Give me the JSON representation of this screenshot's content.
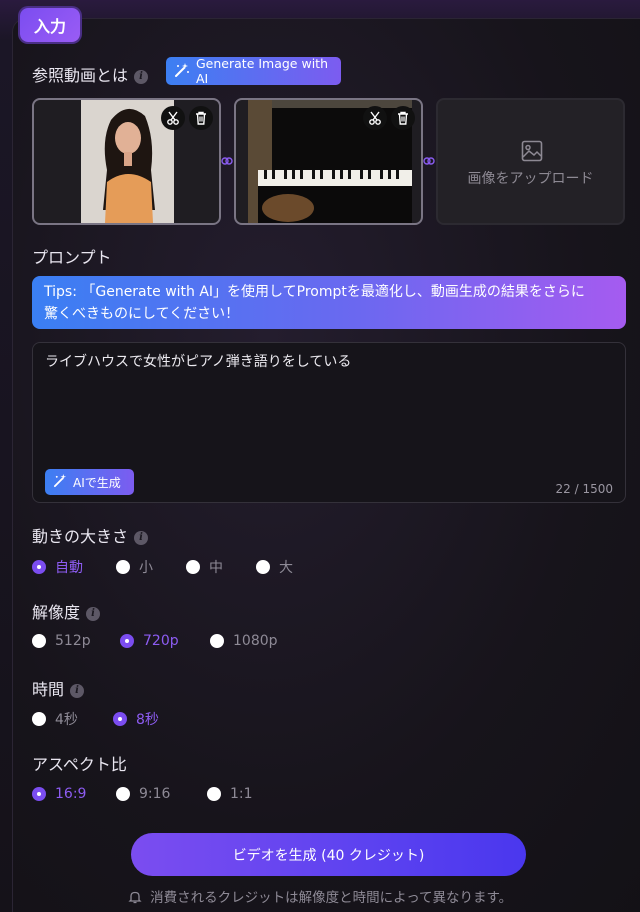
{
  "section_tag": "入力",
  "reference": {
    "label": "参照動画とは",
    "generate_image_label": "Generate Image with AI",
    "upload_label": "画像をアップロード"
  },
  "prompt": {
    "label": "プロンプト",
    "tips_line1": "Tips: 「Generate with AI」を使用してPromptを最適化し、動画生成の結果をさらに",
    "tips_line2": "驚くべきものにしてください！",
    "value": "ライブハウスで女性がピアノ弾き語りをしている",
    "ai_button_label": "AIで生成",
    "counter": "22 / 1500"
  },
  "motion": {
    "label": "動きの大きさ",
    "options": [
      "自動",
      "小",
      "中",
      "大"
    ],
    "selected": "自動"
  },
  "resolution": {
    "label": "解像度",
    "options": [
      "512p",
      "720p",
      "1080p"
    ],
    "selected": "720p"
  },
  "duration": {
    "label": "時間",
    "options": [
      "4秒",
      "8秒"
    ],
    "selected": "8秒"
  },
  "aspect": {
    "label": "アスペクト比",
    "options": [
      "16:9",
      "9:16",
      "1:1"
    ],
    "selected": "16:9"
  },
  "generate_button": "ビデオを生成 (40 クレジット)",
  "footer_note": "消費されるクレジットは解像度と時間によって異なります。",
  "colors": {
    "accent": "#7b4df0",
    "blue": "#3c7ff2"
  }
}
